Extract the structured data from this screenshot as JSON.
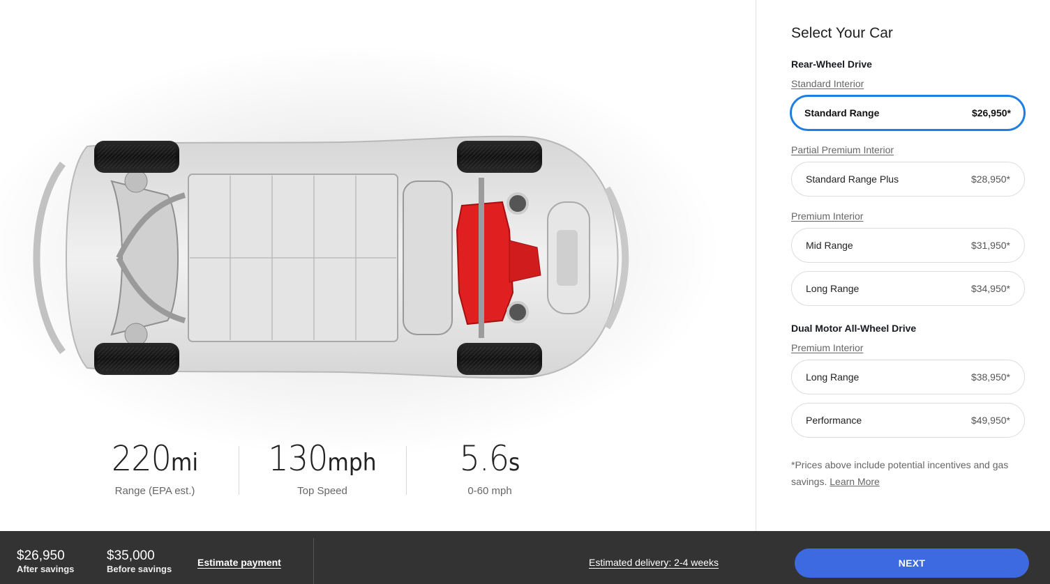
{
  "car": {
    "image_alt": "Model 3 chassis top view",
    "motor_color": "#e02020"
  },
  "specs": [
    {
      "value": "220",
      "unit": "mi",
      "label": "Range (EPA est.)"
    },
    {
      "value": "130",
      "unit": "mph",
      "label": "Top Speed"
    },
    {
      "value": "5.6",
      "unit": "s",
      "label": "0-60 mph"
    }
  ],
  "panel": {
    "title": "Select Your Car",
    "groups": [
      {
        "drive": "Rear-Wheel Drive",
        "interiors": [
          {
            "name": "Standard Interior",
            "options": [
              {
                "name": "Standard Range",
                "price": "$26,950*",
                "selected": true
              }
            ]
          },
          {
            "name": "Partial Premium Interior",
            "options": [
              {
                "name": "Standard Range Plus",
                "price": "$28,950*",
                "selected": false
              }
            ]
          },
          {
            "name": "Premium Interior",
            "options": [
              {
                "name": "Mid Range",
                "price": "$31,950*",
                "selected": false
              },
              {
                "name": "Long Range",
                "price": "$34,950*",
                "selected": false
              }
            ]
          }
        ]
      },
      {
        "drive": "Dual Motor All-Wheel Drive",
        "interiors": [
          {
            "name": "Premium Interior",
            "options": [
              {
                "name": "Long Range",
                "price": "$38,950*",
                "selected": false
              },
              {
                "name": "Performance",
                "price": "$49,950*",
                "selected": false
              }
            ]
          }
        ]
      }
    ],
    "footnote": "*Prices above include potential incentives and gas savings.",
    "learn_more": "Learn More",
    "accent_color": "#1f7fe0"
  },
  "footer": {
    "after_savings_price": "$26,950",
    "after_savings_label": "After savings",
    "before_savings_price": "$35,000",
    "before_savings_label": "Before savings",
    "estimate_payment": "Estimate payment",
    "delivery": "Estimated delivery: 2-4 weeks",
    "next_label": "NEXT",
    "next_color": "#3e6ae1"
  }
}
